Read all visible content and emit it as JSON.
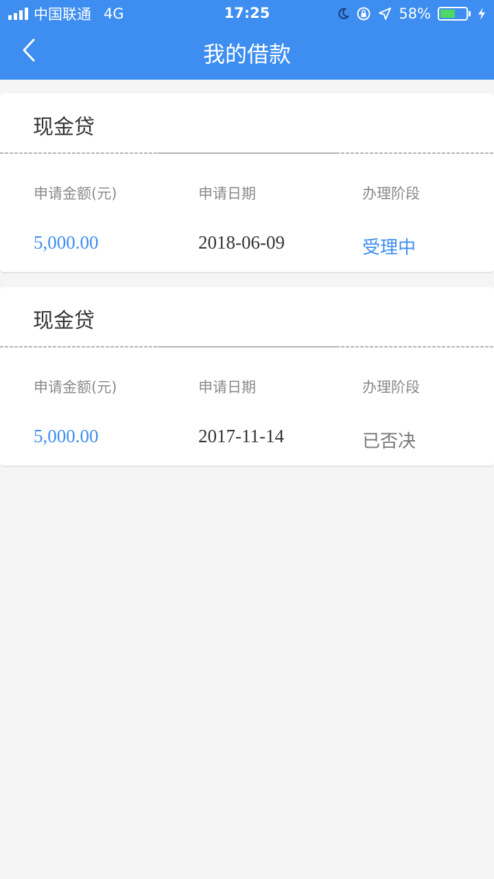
{
  "status_bar": {
    "carrier": "中国联通",
    "network": "4G",
    "time": "17:25",
    "battery_percent_text": "58%",
    "battery_level": 0.58,
    "icons": [
      "signal-icon",
      "moon-icon",
      "rotation-lock-icon",
      "location-arrow-icon",
      "battery-icon",
      "charging-bolt-icon"
    ]
  },
  "nav": {
    "title": "我的借款",
    "back_icon": "chevron-left-icon"
  },
  "loans": [
    {
      "type": "现金贷",
      "label_amount": "申请金额(元)",
      "label_date": "申请日期",
      "label_stage": "办理阶段",
      "amount": "5,000.00",
      "date": "2018-06-09",
      "stage": "受理中"
    },
    {
      "type": "现金贷",
      "label_amount": "申请金额(元)",
      "label_date": "申请日期",
      "label_stage": "办理阶段",
      "amount": "5,000.00",
      "date": "2017-11-14",
      "stage": "已否决"
    }
  ],
  "colors": {
    "brand": "#3d8ef0",
    "amount": "#3d8ef0",
    "stage_in_progress": "#3d8ef0",
    "stage_rejected": "#777777",
    "background": "#f5f5f5"
  }
}
